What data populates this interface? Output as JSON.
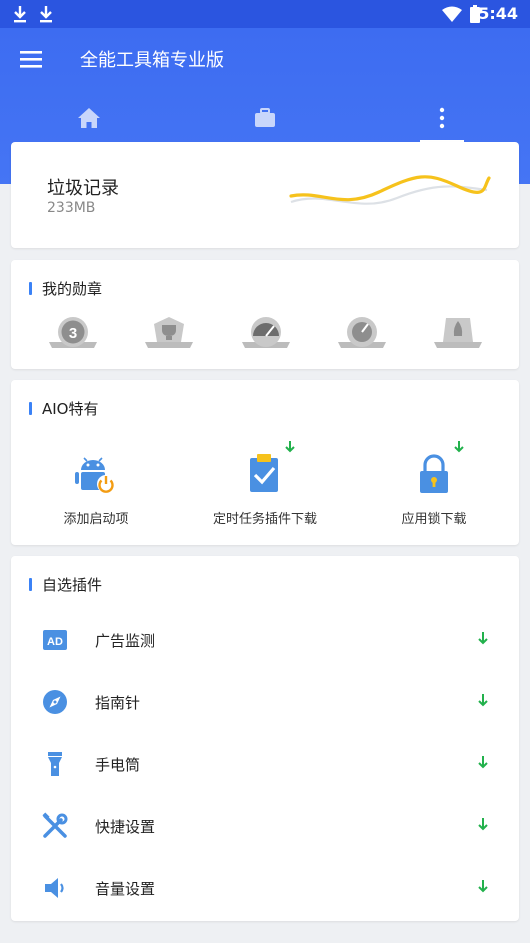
{
  "status_bar": {
    "time": "5:44",
    "left_icons": [
      "download-icon",
      "download-icon"
    ],
    "right_icons": [
      "wifi-icon",
      "battery-icon"
    ]
  },
  "header": {
    "title": "全能工具箱专业版",
    "tabs": [
      {
        "icon": "home-icon",
        "active": false
      },
      {
        "icon": "toolbox-icon",
        "active": false
      },
      {
        "icon": "more-vert-icon",
        "active": true
      }
    ]
  },
  "junk": {
    "title": "垃圾记录",
    "size": "233MB"
  },
  "medals": {
    "title": "我的勋章",
    "items": [
      {
        "icon": "medal-3-days-icon"
      },
      {
        "icon": "medal-trophy-icon"
      },
      {
        "icon": "medal-speed-icon"
      },
      {
        "icon": "medal-gauge-icon"
      },
      {
        "icon": "medal-rocket-icon"
      }
    ]
  },
  "aio": {
    "title": "AIO特有",
    "items": [
      {
        "label": "添加启动项",
        "icon": "android-power-icon",
        "downloadable": false
      },
      {
        "label": "定时任务插件下载",
        "icon": "clipboard-check-icon",
        "downloadable": true
      },
      {
        "label": "应用锁下载",
        "icon": "lock-icon",
        "downloadable": true
      }
    ]
  },
  "plugins": {
    "title": "自选插件",
    "items": [
      {
        "label": "广告监测",
        "icon": "ad-icon"
      },
      {
        "label": "指南针",
        "icon": "compass-icon"
      },
      {
        "label": "手电筒",
        "icon": "flashlight-icon"
      },
      {
        "label": "快捷设置",
        "icon": "tools-icon"
      },
      {
        "label": "音量设置",
        "icon": "volume-icon"
      }
    ]
  },
  "colors": {
    "primary": "#3d6cf1",
    "accent_blue": "#3b82f6",
    "download_green": "#22b14c",
    "wave_yellow": "#f6c21c"
  }
}
